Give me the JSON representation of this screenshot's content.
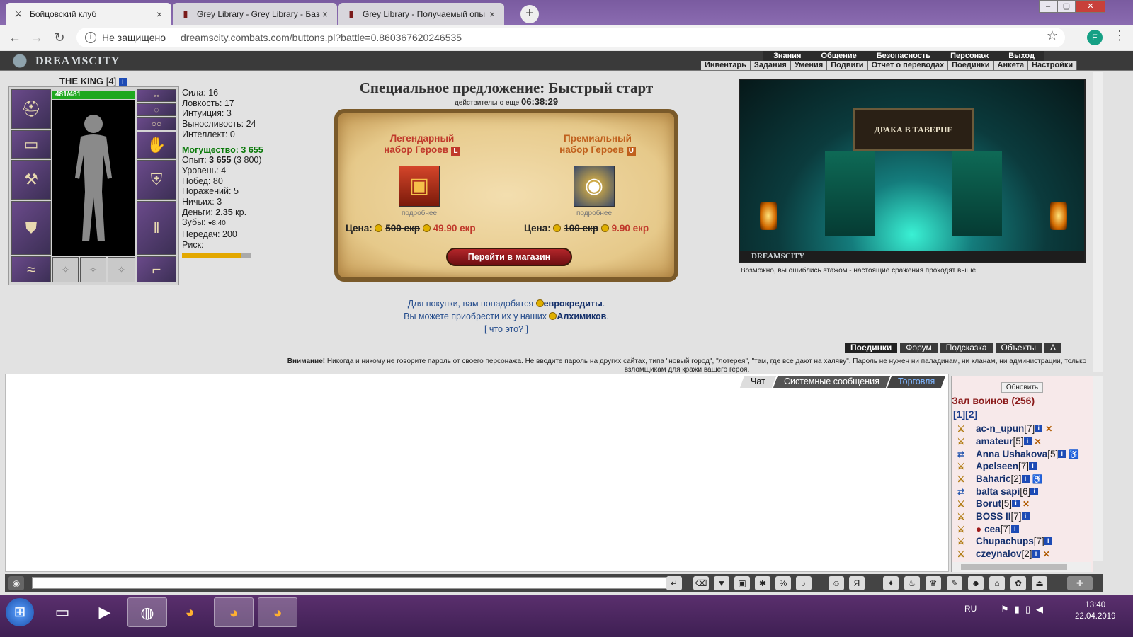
{
  "browser": {
    "tabs": [
      {
        "title": "Бойцовский клуб",
        "icon": "swords-icon",
        "active": true
      },
      {
        "title": "Grey Library - Grey Library - База",
        "icon": "library-icon",
        "active": false
      },
      {
        "title": "Grey Library - Получаемый опы",
        "icon": "library-icon",
        "active": false
      }
    ],
    "new_tab": "+",
    "security_label": "Не защищено",
    "url": "dreamscity.combats.com/buttons.pl?battle=0.860367620246535",
    "profile_initial": "E"
  },
  "game_header": {
    "logo": "DREAMSCITY",
    "top_menu": [
      "Знания",
      "Общение",
      "Безопасность",
      "Персонаж",
      "Выход"
    ],
    "sub_menu": [
      "Инвентарь",
      "Задания",
      "Умения",
      "Подвиги",
      "Отчет о переводах",
      "Поединки",
      "Анкета",
      "Настройки"
    ]
  },
  "character": {
    "name": "THE KING",
    "level": "[4]",
    "hp": "481/481",
    "stats": [
      {
        "label": "Сила:",
        "value": "16"
      },
      {
        "label": "Ловкость:",
        "value": "17"
      },
      {
        "label": "Интуиция:",
        "value": "3"
      },
      {
        "label": "Выносливость:",
        "value": "24"
      },
      {
        "label": "Интеллект:",
        "value": "0"
      }
    ],
    "might": "Могущество: 3 655",
    "exp_label": "Опыт:",
    "exp_value": "3 655",
    "exp_next": "(3 800)",
    "level_line": "Уровень: 4",
    "wins": "Побед: 80",
    "losses": "Поражений: 5",
    "draws": "Ничьих: 3",
    "money_label": "Деньги:",
    "money_value": "2.35",
    "money_unit": "кр.",
    "teeth_label": "Зубы:",
    "teeth_value": "8.40",
    "transfers": "Передач: 200",
    "risk_label": "Риск:",
    "risk_fraction": 0.85
  },
  "offer": {
    "title": "Специальное предложение: Быстрый старт",
    "timer_label": "действительно еще",
    "timer_value": "06:38:29",
    "sets": [
      {
        "name_line1": "Легендарный",
        "name_line2": "набор Героев",
        "tag": "L",
        "more": "подробнее",
        "price_label": "Цена:",
        "old_price": "500 екр",
        "new_price": "49.90 екр"
      },
      {
        "name_line1": "Премиальный",
        "name_line2": "набор Героев",
        "tag": "U",
        "more": "подробнее",
        "price_label": "Цена:",
        "old_price": "100 екр",
        "new_price": "9.90 екр"
      }
    ],
    "shop_button": "Перейти в магазин"
  },
  "buy_info": {
    "line1_text": "Для покупки, вам понадобятся ",
    "line1_link": "еврокредиты",
    "line2_text": "Вы можете приобрести их у наших ",
    "line2_link": "Алхимиков",
    "line3": "[ что это? ]"
  },
  "location": {
    "banner": "ДРАКА В ТАВЕРНЕ",
    "caption": "DREAMSCITY",
    "note": "Возможно, вы ошиблись этажом - настоящие сражения проходят выше."
  },
  "game_buttons": [
    "Поединки",
    "Форум",
    "Подсказка",
    "Объекты",
    "Δ"
  ],
  "warning": {
    "bold": "Внимание!",
    "text": " Никогда и никому не говорите пароль от своего персонажа. Не вводите пароль на других сайтах, типа \"новый город\", \"лотерея\", \"там, где все дают на халяву\". Пароль не нужен ни паладинам, ни кланам, ни администрации, только взломщикам для кражи вашего героя."
  },
  "chat": {
    "tabs": [
      "Чат",
      "Системные сообщения",
      "Торговля"
    ]
  },
  "userlist": {
    "refresh": "Обновить",
    "hall": "Зал воинов (256)",
    "pages": "[1][2]",
    "users": [
      {
        "name": "ac-n_upun",
        "level": "[7]",
        "status": "✕"
      },
      {
        "name": "amateur",
        "level": "[5]",
        "status": "✕"
      },
      {
        "name": "Anna Ushakova",
        "level": "[5]",
        "status": "♿"
      },
      {
        "name": "Apelseen",
        "level": "[7]",
        "status": ""
      },
      {
        "name": "Baharic",
        "level": "[2]",
        "status": "♿"
      },
      {
        "name": "balta sapi",
        "level": "[6]",
        "status": ""
      },
      {
        "name": "Borut",
        "level": "[5]",
        "status": "✕"
      },
      {
        "name": "BOSS II",
        "level": "[7]",
        "status": ""
      },
      {
        "name": "cea",
        "level": "[7]",
        "status": ""
      },
      {
        "name": "Chupachups",
        "level": "[7]",
        "status": ""
      },
      {
        "name": "czeynalov",
        "level": "[2]",
        "status": "✕"
      }
    ]
  },
  "taskbar": {
    "lang": "RU",
    "time": "13:40",
    "date": "22.04.2019"
  }
}
